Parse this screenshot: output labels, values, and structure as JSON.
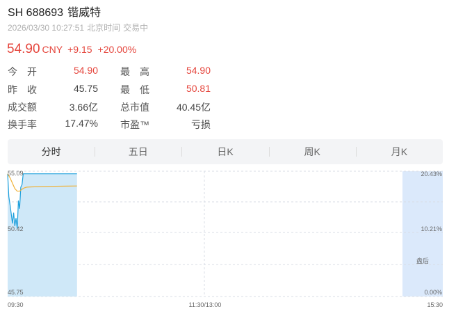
{
  "header": {
    "code": "SH 688693",
    "name": "锴威特",
    "datetime": "2026/03/30 10:27:51",
    "timezone": "北京时间",
    "status": "交易中"
  },
  "quote": {
    "price": "54.90",
    "currency": "CNY",
    "change": "+9.15",
    "change_pct": "+20.00%"
  },
  "stats": [
    {
      "label": "今　开",
      "value": "54.90",
      "color": "red"
    },
    {
      "label": "最　高",
      "value": "54.90",
      "color": "red"
    },
    {
      "label": "昨　收",
      "value": "45.75",
      "color": "dark"
    },
    {
      "label": "最　低",
      "value": "50.81",
      "color": "red"
    },
    {
      "label": "成交额",
      "value": "3.66亿",
      "color": "dark"
    },
    {
      "label": "总市值",
      "value": "40.45亿",
      "color": "dark"
    },
    {
      "label": "换手率",
      "value": "17.47%",
      "color": "dark"
    },
    {
      "label": "市盈™",
      "value": "亏损",
      "color": "dark"
    }
  ],
  "tabs": [
    {
      "label": "分时",
      "active": true
    },
    {
      "label": "五日",
      "active": false
    },
    {
      "label": "日K",
      "active": false
    },
    {
      "label": "周K",
      "active": false
    },
    {
      "label": "月K",
      "active": false
    }
  ],
  "chart_data": {
    "type": "line",
    "y_ticks_left": [
      "55.09",
      "50.42",
      "45.75"
    ],
    "y_ticks_right": [
      "20.43%",
      "10.21%",
      "0.00%"
    ],
    "x_ticks": [
      "09:30",
      "11:30/13:00",
      "15:30"
    ],
    "after_hours_label": "盘后",
    "ylim": [
      45.75,
      55.09
    ],
    "series": [
      {
        "role": "price",
        "color": "#1ea0dc",
        "points": [
          [
            0,
            54.9
          ],
          [
            1,
            53.2
          ],
          [
            2,
            52.6
          ],
          [
            3,
            51.9
          ],
          [
            4,
            51.2
          ],
          [
            5,
            52.0
          ],
          [
            6,
            51.0
          ],
          [
            7,
            51.6
          ],
          [
            8,
            50.81
          ],
          [
            9,
            52.9
          ],
          [
            10,
            52.3
          ],
          [
            11,
            53.9
          ],
          [
            12,
            54.1
          ],
          [
            13,
            54.9
          ],
          [
            14,
            54.9
          ],
          [
            15,
            54.9
          ],
          [
            16,
            54.9
          ],
          [
            17,
            54.9
          ],
          [
            18,
            54.9
          ],
          [
            20,
            54.9
          ],
          [
            30,
            54.9
          ],
          [
            40,
            54.9
          ],
          [
            50,
            54.9
          ],
          [
            58,
            54.9
          ]
        ]
      },
      {
        "role": "average",
        "color": "#f0b23a",
        "points": [
          [
            0,
            54.9
          ],
          [
            2,
            54.6
          ],
          [
            4,
            54.2
          ],
          [
            6,
            53.8
          ],
          [
            8,
            53.6
          ],
          [
            10,
            53.6
          ],
          [
            12,
            53.75
          ],
          [
            14,
            53.85
          ],
          [
            16,
            53.9
          ],
          [
            20,
            53.92
          ],
          [
            30,
            53.95
          ],
          [
            40,
            53.97
          ],
          [
            50,
            53.98
          ],
          [
            58,
            53.99
          ]
        ]
      }
    ],
    "total_minutes": 330,
    "colors": {
      "area": "#cfe8f8",
      "after_hours_bg": "#dbe9fb",
      "grid": "#d8dde5"
    }
  }
}
